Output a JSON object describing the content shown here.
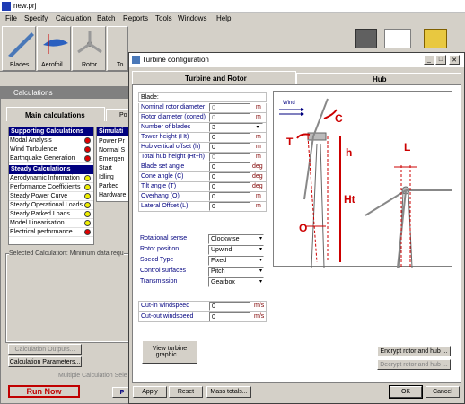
{
  "app": {
    "title": "new.prj",
    "menu": [
      "File",
      "Specify",
      "Calculation",
      "Batch",
      "Reports",
      "Tools",
      "Windows",
      "Help"
    ],
    "toolbar": [
      "Blades",
      "Aerofoil",
      "Rotor",
      "To"
    ]
  },
  "calc_window": {
    "title": "Calculations",
    "tabs": [
      "Main calculations",
      "Po"
    ],
    "sections": [
      {
        "header": "Supporting Calculations",
        "items": [
          {
            "label": "Modal Analysis",
            "status": "red"
          },
          {
            "label": "Wind Turbulence",
            "status": "red"
          },
          {
            "label": "Earthquake Generation",
            "status": "red"
          }
        ]
      },
      {
        "header": "Steady Calculations",
        "items": [
          {
            "label": "Aerodynamic Information",
            "status": "yellow"
          },
          {
            "label": "Performance Coefficients",
            "status": "yellow"
          },
          {
            "label": "Steady Power Curve",
            "status": "yellow"
          },
          {
            "label": "Steady Operational Loads",
            "status": "yellow"
          },
          {
            "label": "Steady Parked Loads",
            "status": "yellow"
          },
          {
            "label": "Model Linearisation",
            "status": "yellow"
          },
          {
            "label": "Electrical performance",
            "status": "red"
          }
        ]
      }
    ],
    "simulation": {
      "header": "Simulati",
      "items": [
        "Power Pr",
        "Normal S",
        "Emergen",
        "Start",
        "Idling",
        "Parked",
        "Hardware"
      ]
    },
    "selected_calc": "Selected Calculation: Minimum data requ",
    "calc_outputs_label": "Calculation Outputs...",
    "calc_params_label": "Calculation Parameters...",
    "multiple_calc_label": "Multiple Calculation Sele",
    "run_now_label": "Run Now",
    "partial_button": "P"
  },
  "dialog": {
    "title": "Turbine configuration",
    "tabs": [
      "Turbine and Rotor",
      "Hub"
    ],
    "blade_label": "Blade:",
    "params": [
      {
        "label": "Nominal rotor diameter",
        "value": "0",
        "unit": "m",
        "enabled": false
      },
      {
        "label": "Rotor diameter (coned)",
        "value": "0",
        "unit": "m",
        "enabled": false
      },
      {
        "label": "Number of blades",
        "value": "3",
        "unit": "",
        "enabled": true,
        "dropdown": true
      },
      {
        "label": "Tower height (Ht)",
        "value": "0",
        "unit": "m",
        "enabled": true
      },
      {
        "label": "Hub vertical offset (h)",
        "value": "0",
        "unit": "m",
        "enabled": true
      },
      {
        "label": "Total hub height (Ht+h)",
        "value": "0",
        "unit": "m",
        "enabled": false
      },
      {
        "label": "Blade set angle",
        "value": "0",
        "unit": "deg",
        "enabled": true
      },
      {
        "label": "Cone angle (C)",
        "value": "0",
        "unit": "deg",
        "enabled": true
      },
      {
        "label": "Tilt angle (T)",
        "value": "0",
        "unit": "deg",
        "enabled": true
      },
      {
        "label": "Overhang (O)",
        "value": "0",
        "unit": "m",
        "enabled": true
      },
      {
        "label": "Lateral Offset (L)",
        "value": "0",
        "unit": "m",
        "enabled": true
      }
    ],
    "options": [
      {
        "label": "Rotational sense",
        "value": "Clockwise"
      },
      {
        "label": "Rotor position",
        "value": "Upwind"
      },
      {
        "label": "Speed Type",
        "value": "Fixed"
      },
      {
        "label": "Control surfaces",
        "value": "Pitch"
      },
      {
        "label": "Transmission",
        "value": "Gearbox"
      }
    ],
    "windspeeds": [
      {
        "label": "Cut-in windspeed",
        "value": "0",
        "unit": "m/s"
      },
      {
        "label": "Cut-out windspeed",
        "value": "0",
        "unit": "m/s"
      }
    ],
    "diagram": {
      "wind": "Wind",
      "C": "C",
      "T": "T",
      "h": "h",
      "L": "L",
      "Ht": "Ht",
      "O": "O"
    },
    "view_graphic_label": "View turbine graphic ...",
    "encrypt_label": "Encrypt rotor and hub ...",
    "decrypt_label": "Decrypt rotor and hub ...",
    "apply_label": "Apply",
    "reset_label": "Reset",
    "mass_label": "Mass totals...",
    "ok_label": "OK",
    "cancel_label": "Cancel"
  }
}
